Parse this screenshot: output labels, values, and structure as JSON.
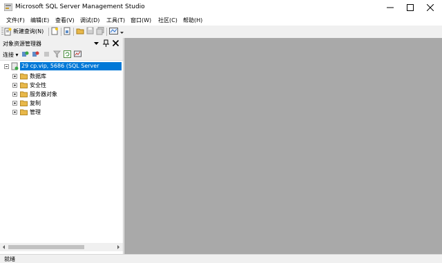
{
  "window": {
    "title": "Microsoft SQL Server Management Studio"
  },
  "menu": [
    {
      "label": "文件(F)"
    },
    {
      "label": "编辑(E)"
    },
    {
      "label": "查看(V)"
    },
    {
      "label": "调试(D)"
    },
    {
      "label": "工具(T)"
    },
    {
      "label": "窗口(W)"
    },
    {
      "label": "社区(C)"
    },
    {
      "label": "帮助(H)"
    }
  ],
  "toolbar": {
    "new_query_label": "新建查询(N)",
    "icons": [
      "new-query-icon",
      "new-file-icon",
      "new-project-icon",
      "open-file-icon",
      "save-icon",
      "save-all-icon",
      "print-icon",
      "activity-monitor-icon"
    ]
  },
  "object_explorer": {
    "title": "对象资源管理器",
    "connect_label": "连接",
    "server_label": "29               cp.vip, 5686   (SQL Server",
    "nodes": [
      {
        "label": "数据库"
      },
      {
        "label": "安全性"
      },
      {
        "label": "服务器对象"
      },
      {
        "label": "复制"
      },
      {
        "label": "管理"
      }
    ]
  },
  "status": {
    "text": "就绪"
  },
  "colors": {
    "selection": "#0078d7",
    "workspace": "#a9a9a9",
    "folder": "#e8b84a"
  }
}
